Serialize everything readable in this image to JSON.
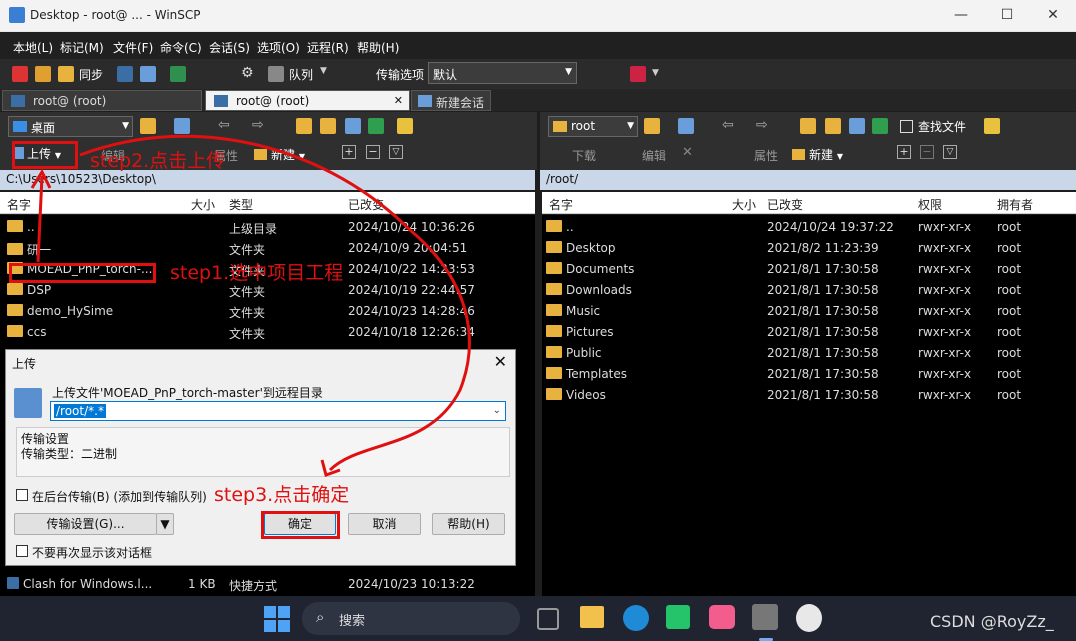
{
  "window": {
    "title": "Desktop - root@ ... - WinSCP",
    "minimize": "—",
    "maximize": "☐",
    "close": "✕"
  },
  "menu": [
    "本地(L)",
    "标记(M)",
    "文件(F)",
    "命令(C)",
    "会话(S)",
    "选项(O)",
    "远程(R)",
    "帮助(H)"
  ],
  "toolbar": {
    "sync_label": "同步",
    "queue_label": "队列",
    "transfer_options_label": "传输选项",
    "transfer_preset": "默认"
  },
  "tabs": [
    {
      "label": "root@         (root)"
    },
    {
      "label": "root@         (root)"
    },
    {
      "label": "新建会话"
    }
  ],
  "left": {
    "location": "桌面",
    "upload_label": "上传",
    "edit_label": "编辑",
    "props_label": "属性",
    "new_label": "新建",
    "path": "C:\\Users\\10523\\Desktop\\",
    "columns": {
      "name": "名字",
      "size": "大小",
      "type": "类型",
      "changed": "已改变"
    },
    "rows": [
      {
        "name": "..",
        "size": "",
        "type": "上级目录",
        "changed": "2024/10/24  10:36:26"
      },
      {
        "name": "研一",
        "size": "",
        "type": "文件夹",
        "changed": "2024/10/9   20:04:51"
      },
      {
        "name": "MOEAD_PnP_torch-...",
        "size": "",
        "type": "文件夹",
        "changed": "2024/10/22  14:23:53"
      },
      {
        "name": "DSP",
        "size": "",
        "type": "文件夹",
        "changed": "2024/10/19  22:44:57"
      },
      {
        "name": "demo_HySime",
        "size": "",
        "type": "文件夹",
        "changed": "2024/10/23  14:28:46"
      },
      {
        "name": "ccs",
        "size": "",
        "type": "文件夹",
        "changed": "2024/10/18  12:26:34"
      }
    ],
    "bottom_rows": [
      {
        "name": "Clash for Windows.l...",
        "size": "1 KB",
        "type": "快捷方式",
        "changed": "2024/10/23  10:13:22"
      }
    ]
  },
  "right": {
    "location": "root",
    "download_label": "下载",
    "edit_label": "编辑",
    "props_label": "属性",
    "new_label": "新建",
    "find_label": "查找文件",
    "path": "/root/",
    "columns": {
      "name": "名字",
      "size": "大小",
      "changed": "已改变",
      "rights": "权限",
      "owner": "拥有者"
    },
    "rows": [
      {
        "name": "..",
        "changed": "2024/10/24 19:37:22",
        "rights": "rwxr-xr-x",
        "owner": "root"
      },
      {
        "name": "Desktop",
        "changed": "2021/8/2 11:23:39",
        "rights": "rwxr-xr-x",
        "owner": "root"
      },
      {
        "name": "Documents",
        "changed": "2021/8/1 17:30:58",
        "rights": "rwxr-xr-x",
        "owner": "root"
      },
      {
        "name": "Downloads",
        "changed": "2021/8/1 17:30:58",
        "rights": "rwxr-xr-x",
        "owner": "root"
      },
      {
        "name": "Music",
        "changed": "2021/8/1 17:30:58",
        "rights": "rwxr-xr-x",
        "owner": "root"
      },
      {
        "name": "Pictures",
        "changed": "2021/8/1 17:30:58",
        "rights": "rwxr-xr-x",
        "owner": "root"
      },
      {
        "name": "Public",
        "changed": "2021/8/1 17:30:58",
        "rights": "rwxr-xr-x",
        "owner": "root"
      },
      {
        "name": "Templates",
        "changed": "2021/8/1 17:30:58",
        "rights": "rwxr-xr-x",
        "owner": "root"
      },
      {
        "name": "Videos",
        "changed": "2021/8/1 17:30:58",
        "rights": "rwxr-xr-x",
        "owner": "root"
      }
    ]
  },
  "dialog": {
    "title": "上传",
    "close": "✕",
    "prompt": "上传文件'MOEAD_PnP_torch-master'到远程目录",
    "target": "/root/*.*",
    "settings_title": "传输设置",
    "settings_line": "传输类型：二进制",
    "bg_transfer": "在后台传输(B) (添加到传输队列)",
    "settings_button": "传输设置(G)...",
    "ok": "确定",
    "cancel": "取消",
    "help": "帮助(H)",
    "dont_show": "不要再次显示该对话框"
  },
  "annotations": {
    "step1": "step1.选中项目工程",
    "step2": "step2.点击上传",
    "step3": "step3.点击确定"
  },
  "taskbar": {
    "search": "搜索"
  },
  "watermark": "CSDN @RoyZz_",
  "colors": {
    "annotation": "#e01010",
    "selection": "#1e3a5f",
    "folder": "#e8b23e",
    "path_bar": "#c9d7e8"
  }
}
